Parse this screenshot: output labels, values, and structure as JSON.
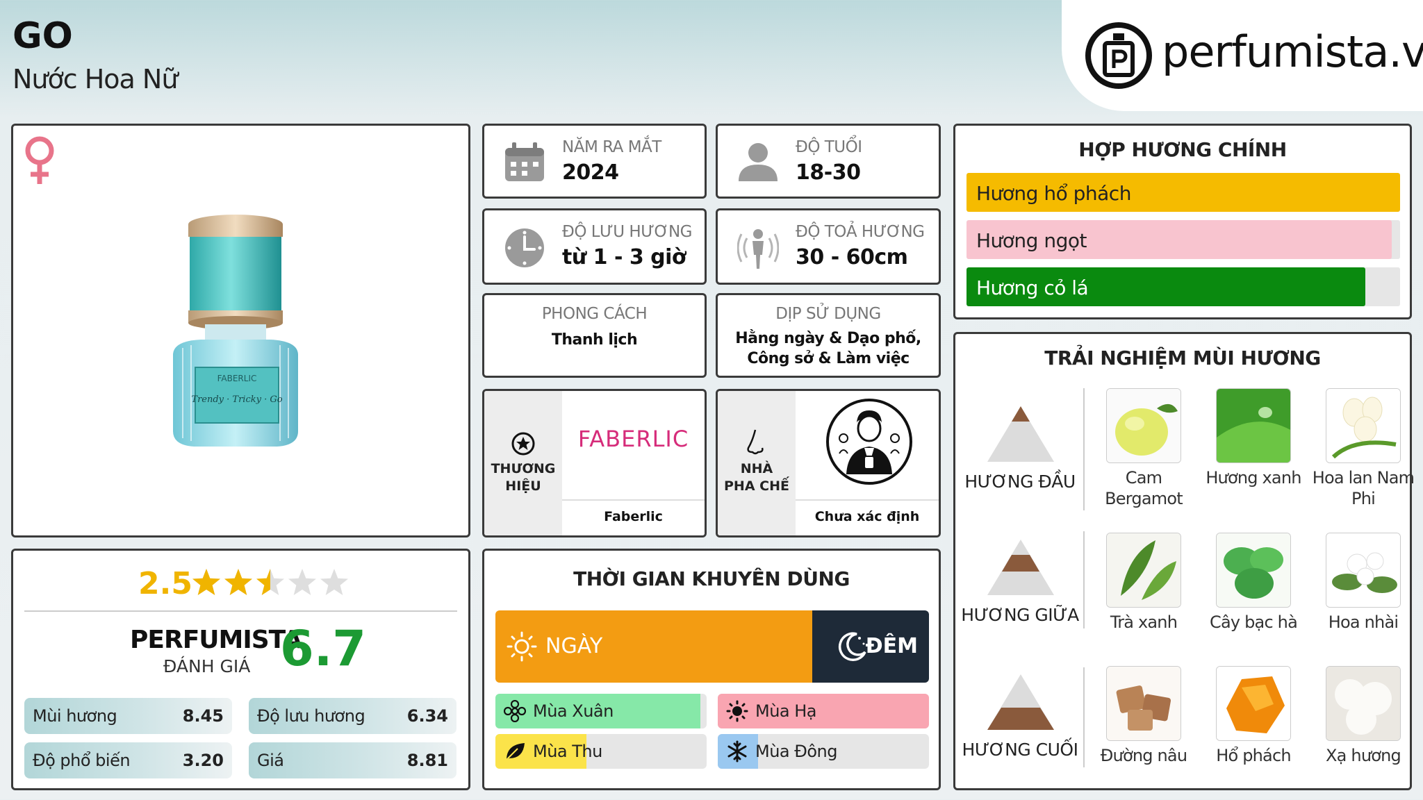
{
  "header": {
    "title": "GO",
    "subtitle": "Nước Hoa Nữ",
    "logo_text": "perfumista.vn"
  },
  "product": {
    "gender_icon": "female-icon",
    "bottle_brand": "FABERLIC",
    "bottle_label": "Trendy · Tricky · Go"
  },
  "info": {
    "release": {
      "label": "NĂM RA MẮT",
      "value": "2024",
      "icon": "calendar-icon"
    },
    "age": {
      "label": "ĐỘ TUỔI",
      "value": "18-30",
      "icon": "person-icon"
    },
    "longevity": {
      "label": "ĐỘ LƯU HƯƠNG",
      "value": "từ 1 - 3 giờ",
      "icon": "clock-icon"
    },
    "sillage": {
      "label": "ĐỘ TOẢ HƯƠNG",
      "value": "30 - 60cm",
      "icon": "sillage-icon"
    },
    "style": {
      "label": "PHONG CÁCH",
      "value": "Thanh lịch"
    },
    "occasion": {
      "label": "DỊP SỬ DỤNG",
      "value": "Hằng ngày & Dạo phố, Công sở & Làm việc"
    },
    "brand": {
      "caption": "THƯƠNG HIỆU",
      "logo": "FABERLIC",
      "name": "Faberlic",
      "icon": "star-badge-icon"
    },
    "perfumer": {
      "caption": "NHÀ PHA CHẾ",
      "name": "Chưa xác định",
      "icon": "nose-icon"
    }
  },
  "rating": {
    "score": "2.5",
    "stars_value": 2.5,
    "stars_max": 5,
    "perfumista_label": "PERFUMISTA",
    "danh_gia_label": "ĐÁNH GIÁ",
    "perfumista_score": "6.7",
    "bars": [
      {
        "label": "Mùi hương",
        "value": "8.45"
      },
      {
        "label": "Độ lưu hương",
        "value": "6.34"
      },
      {
        "label": "Độ phổ biến",
        "value": "3.20"
      },
      {
        "label": "Giá",
        "value": "8.81"
      }
    ]
  },
  "time": {
    "title": "THỜI GIAN KHUYÊN DÙNG",
    "day_label": "NGÀY",
    "night_label": "ĐÊM",
    "day_fraction": 0.73,
    "seasons": [
      {
        "label": "Mùa Xuân",
        "fraction": 0.97,
        "color": "#86e8a8",
        "icon": "flower-icon"
      },
      {
        "label": "Mùa Hạ",
        "fraction": 1.0,
        "color": "#f9a5b1",
        "icon": "sun-icon"
      },
      {
        "label": "Mùa Thu",
        "fraction": 0.43,
        "color": "#fbe34a",
        "icon": "leaf-icon"
      },
      {
        "label": "Mùa Đông",
        "fraction": 0.19,
        "color": "#9ac8f0",
        "icon": "snowflake-icon"
      }
    ],
    "colors": {
      "day": "#f39c12",
      "night": "#1e2a38"
    }
  },
  "accords": {
    "title": "HỢP HƯƠNG CHÍNH",
    "items": [
      {
        "label": "Hương hổ phách",
        "fraction": 1.0,
        "color": "#f5bb00",
        "text_color": "#222222"
      },
      {
        "label": "Hương ngọt",
        "fraction": 0.98,
        "color": "#f8c4cf",
        "text_color": "#222222"
      },
      {
        "label": "Hương cỏ lá",
        "fraction": 0.92,
        "color": "#0a8a0f",
        "text_color": "#ffffff"
      }
    ]
  },
  "notes": {
    "title": "TRẢI NGHIỆM MÙI HƯƠNG",
    "tiers": [
      {
        "label": "HƯƠNG ĐẦU",
        "items": [
          "Cam Bergamot",
          "Hương xanh",
          "Hoa lan Nam Phi"
        ]
      },
      {
        "label": "HƯƠNG GIỮA",
        "items": [
          "Trà xanh",
          "Cây bạc hà",
          "Hoa nhài"
        ]
      },
      {
        "label": "HƯƠNG CUỐI",
        "items": [
          "Đường nâu",
          "Hổ phách",
          "Xạ hương"
        ]
      }
    ]
  }
}
